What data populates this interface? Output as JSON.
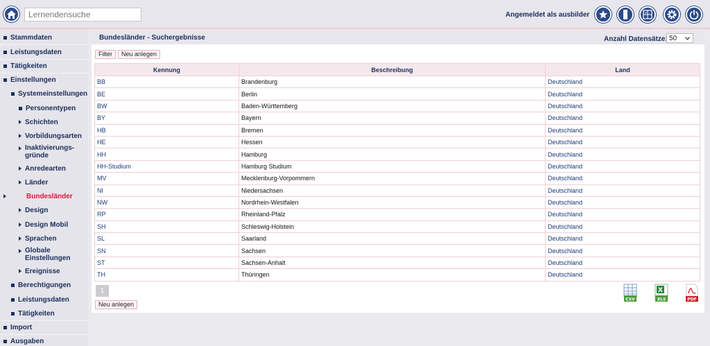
{
  "header": {
    "search_placeholder": "Lernendensuche",
    "login_text": "Angemeldet als ausbilder",
    "icons": [
      "home-icon",
      "star-icon",
      "phone-icon",
      "calculator-icon",
      "gear-icon",
      "power-icon"
    ]
  },
  "sidebar": {
    "stammdaten": "Stammdaten",
    "leistungsdaten": "Leistungsdaten",
    "taetigkeiten": "Tätigkeiten",
    "einstellungen": "Einstellungen",
    "systemeinstellungen": "Systemeinstellungen",
    "personentypen": "Personentypen",
    "schichten": "Schichten",
    "vorbildungsarten": "Vorbildungsarten",
    "inaktivierungsgruende": "Inaktivierungs-gründe",
    "anredearten": "Anredearten",
    "laender": "Länder",
    "bundeslaender": "Bundesländer",
    "design": "Design",
    "design_mobil": "Design Mobil",
    "sprachen": "Sprachen",
    "globale_einstellungen": "Globale Einstellungen",
    "ereignisse": "Ereignisse",
    "berechtigungen": "Berechtigungen",
    "leistungsdaten2": "Leistungsdaten",
    "taetigkeiten2": "Tätigkeiten",
    "import": "Import",
    "ausgaben": "Ausgaben"
  },
  "main": {
    "title": "Bundesländer - Suchergebnisse",
    "records_label": "Anzahl Datensätze:",
    "records_value": "50",
    "filter_button": "Filter",
    "new_button": "Neu anlegen",
    "new_button_bottom": "Neu anlegen",
    "page_number": "1",
    "columns": [
      "Kennung",
      "Beschreibung",
      "Land"
    ],
    "rows": [
      {
        "kennung": "BB",
        "beschreibung": "Brandenburg",
        "land": "Deutschland"
      },
      {
        "kennung": "BE",
        "beschreibung": "Berlin",
        "land": "Deutschland"
      },
      {
        "kennung": "BW",
        "beschreibung": "Baden-Württemberg",
        "land": "Deutschland"
      },
      {
        "kennung": "BY",
        "beschreibung": "Bayern",
        "land": "Deutschland"
      },
      {
        "kennung": "HB",
        "beschreibung": "Bremen",
        "land": "Deutschland"
      },
      {
        "kennung": "HE",
        "beschreibung": "Hessen",
        "land": "Deutschland"
      },
      {
        "kennung": "HH",
        "beschreibung": "Hamburg",
        "land": "Deutschland"
      },
      {
        "kennung": "HH-Studium",
        "beschreibung": "Hamburg Studium",
        "land": "Deutschland"
      },
      {
        "kennung": "MV",
        "beschreibung": "Mecklenburg-Vorpommern",
        "land": "Deutschland"
      },
      {
        "kennung": "NI",
        "beschreibung": "Niedersachsen",
        "land": "Deutschland"
      },
      {
        "kennung": "NW",
        "beschreibung": "Nordrhein-Westfalen",
        "land": "Deutschland"
      },
      {
        "kennung": "RP",
        "beschreibung": "Rheinland-Pfalz",
        "land": "Deutschland"
      },
      {
        "kennung": "SH",
        "beschreibung": "Schleswig-Holstein",
        "land": "Deutschland"
      },
      {
        "kennung": "SL",
        "beschreibung": "Saarland",
        "land": "Deutschland"
      },
      {
        "kennung": "SN",
        "beschreibung": "Sachsen",
        "land": "Deutschland"
      },
      {
        "kennung": "ST",
        "beschreibung": "Sachsen-Anhalt",
        "land": "Deutschland"
      },
      {
        "kennung": "TH",
        "beschreibung": "Thüringen",
        "land": "Deutschland"
      }
    ],
    "exports": {
      "csv": "CSV",
      "xls": "XLS",
      "pdf": "PDF"
    }
  },
  "colors": {
    "accent": "#2c4a8a",
    "active": "#d0203a",
    "border": "#edd0d7"
  }
}
